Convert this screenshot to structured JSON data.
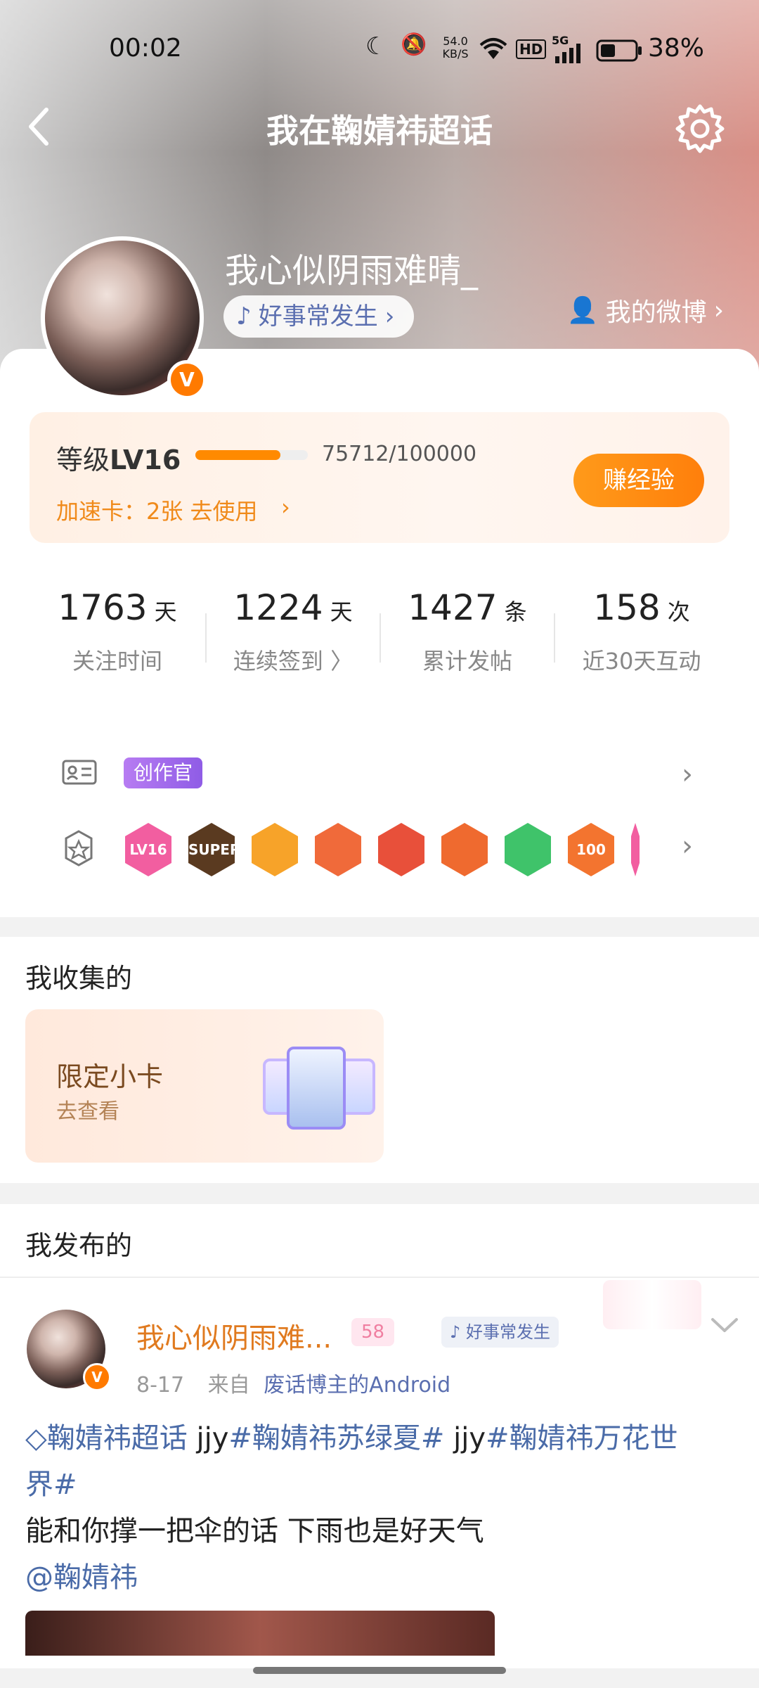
{
  "status_bar": {
    "time": "00:02",
    "net_speed": "54.0 KB/S",
    "hd": "HD",
    "signal": "5G",
    "battery_percent": "38%"
  },
  "header": {
    "back_icon": "back-arrow-icon",
    "title": "我在鞠婧祎超话",
    "settings_icon": "gear-icon"
  },
  "profile": {
    "username": "我心似阴雨难晴_",
    "pill_label": "好事常发生",
    "my_weibo": "我的微博",
    "verified_badge": "V"
  },
  "level": {
    "label": "等级",
    "level": "LV16",
    "progress": 0.75712,
    "exp_text": "75712/100000",
    "speed_card": "加速卡：2张 去使用",
    "earn_button": "赚经验"
  },
  "stats": [
    {
      "value": "1763",
      "unit": "天",
      "label": "关注时间"
    },
    {
      "value": "1224",
      "unit": "天",
      "label": "连续签到 〉"
    },
    {
      "value": "1427",
      "unit": "条",
      "label": "累计发帖"
    },
    {
      "value": "158",
      "unit": "次",
      "label": "近30天互动"
    }
  ],
  "badges": {
    "creator_label": "创作官",
    "medals": [
      "LV16",
      "SUPER",
      "",
      "",
      "",
      "",
      "",
      "100"
    ]
  },
  "collected": {
    "section_title": "我收集的",
    "card_title": "限定小卡",
    "card_subtitle": "去查看"
  },
  "posted": {
    "section_title": "我发布的",
    "post": {
      "author": "我心似阴雨难...",
      "level_tag": "58",
      "author_pill": "好事常发生",
      "date": "8-17",
      "source_prefix": "来自",
      "source": "废话博主的Android",
      "line1_prefix": "鞠婧祎超话",
      "line1_a": " jjy",
      "line1_tag1": "#鞠婧祎苏绿夏#",
      "line1_b": " jjy",
      "line1_tag2": "#鞠婧祎万花世",
      "line2": "界#",
      "line3": "能和你撑一把伞的话 下雨也是好天气",
      "mention": "@鞠婧祎"
    }
  },
  "colors": {
    "accent": "#ff7f0b",
    "link": "#4a6ba8",
    "username_orange": "#e07a1f"
  }
}
